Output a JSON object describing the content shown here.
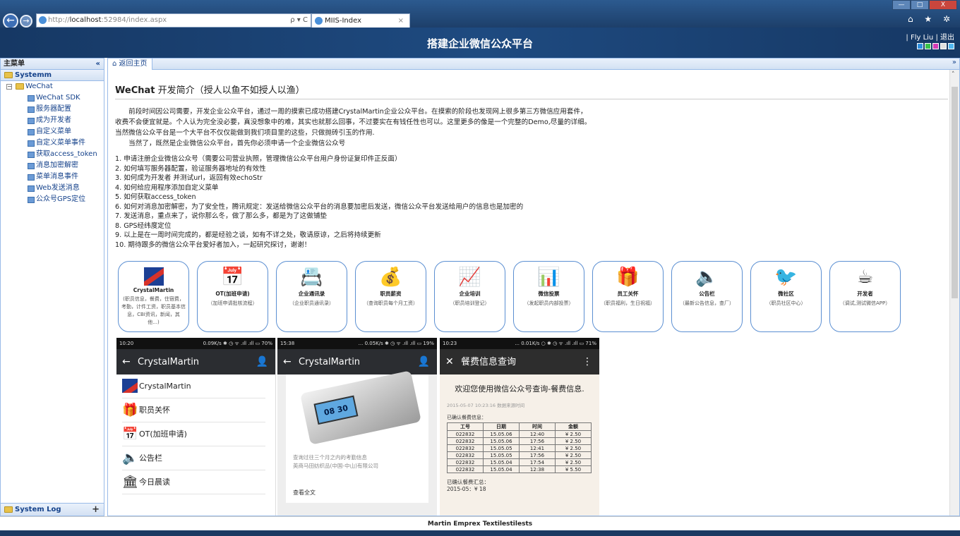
{
  "browser": {
    "url_prefix": "http://",
    "url_host": "localhost",
    "url_rest": ":52984/index.aspx",
    "url_tools": "ρ ▾ C",
    "tab_title": "MIIS-Index",
    "tab_close": "×",
    "icons": "⌂ ★ ✲",
    "win_min": "—",
    "win_max": "□",
    "win_close": "X"
  },
  "header": {
    "title": "搭建企业微信公众平台",
    "user": "| Fly Liu | 退出",
    "swatch_colors": [
      "#2c8fe0",
      "#39c24a",
      "#d63bb5",
      "#e0e0e0",
      "#50b8f2"
    ]
  },
  "sidebar": {
    "title": "主菜单",
    "collapse": "«",
    "system_group": "Systemm",
    "tree_root": "WeChat",
    "items": [
      "WeChat SDK",
      "服务器配置",
      "成为开发者",
      "自定义菜单",
      "自定义菜单事件",
      "获取access_token",
      "消息加密解密",
      "菜单消息事件",
      "Web发送消息",
      "公众号GPS定位"
    ],
    "system_log": "System Log",
    "system_log_plus": "+"
  },
  "main": {
    "home_tab": "⌂ 返回主页",
    "tab_chevron": "»",
    "title_main": "WeChat",
    "title_rest": " 开发简介（授人以鱼不如授人以渔）",
    "intro": [
      "　　前段时间因公司需要，开发企业公众平台，通过一周的摸索已成功搭建CrystalMartin企业公众平台。在摸索的阶段也发现网上很多第三方微信应用套件，",
      "收费不会便宜就是。个人认为完全没必要，真没想象中的难，其实也就那么回事，不过要实在有钱任性也可以。这里更多的像是一个完整的Demo,尽量的详细。",
      "当然微信公众平台是一个大平台不仅仅能做到我们项目里的这些，只做抛砖引玉的作用.",
      "　　当然了，既然是企业微信公众平台，首先你必须申请一个企业微信公众号"
    ],
    "steps": [
      "1. 申请注册企业微信公众号（需要公司营业执照，管理微信公众平台用户身份证复印件正反面）",
      "2. 如何填写服务器配置，验证服务器地址的有效性",
      "3. 如何成为开发者 并测试url，返回有效echoStr",
      "4. 如何给应用程序添加自定义菜单",
      "5. 如何获取access_token",
      "6. 如何对消息加密解密，为了安全性，腾讯规定：发送给微信公众平台的消息要加密后发送，微信公众平台发送给用户的信息也是加密的",
      "7. 发送消息，重点来了，说你那么冬，做了那么多，都是为了这做铺垫",
      "8. GPS经纬度定位",
      "9. 以上是在一周时间完成的，都是经验之谈，如有不详之处，敬请原谅，之后将持续更新",
      "10. 期待跟多的微信公众平台爱好者加入，一起研究探讨，谢谢！"
    ]
  },
  "cards": [
    {
      "icon": "logo",
      "glyph": "",
      "title": "CrystalMartin",
      "sub": "(职员信息，餐费，住宿费，考勤，计件工资，职员基本信息，CBI资讯，新闻，其他...)"
    },
    {
      "icon": "calendar-check-icon",
      "glyph": "📅",
      "title": "OT(加班申请)",
      "sub": "（加班申请批核流程）"
    },
    {
      "icon": "contacts-icon",
      "glyph": "📇",
      "title": "企业通讯录",
      "sub": "（企业职员通讯录）"
    },
    {
      "icon": "money-bag-icon",
      "glyph": "💰",
      "title": "职员薪资",
      "sub": "（查询职员每个月工资）"
    },
    {
      "icon": "presentation-icon",
      "glyph": "📈",
      "title": "企业培训",
      "sub": "（职员培训登记）"
    },
    {
      "icon": "bar-chart-icon",
      "glyph": "📊",
      "title": "微信投票",
      "sub": "（发起职员内部投票）"
    },
    {
      "icon": "gift-icon",
      "glyph": "🎁",
      "title": "员工关怀",
      "sub": "（职员福利，生日祝福）"
    },
    {
      "icon": "speaker-icon",
      "glyph": "🔈",
      "title": "公告栏",
      "sub": "（最新公告信息，查厂）"
    },
    {
      "icon": "bird-icon",
      "glyph": "🐦",
      "title": "微社区",
      "sub": "（职员社区中心）"
    },
    {
      "icon": "coffee-java-icon",
      "glyph": "☕",
      "title": "开发者",
      "sub": "（调试,测试微信APP）"
    }
  ],
  "phone1": {
    "time": "10:20",
    "status": "0.09K/s ✱ ◷ ᯤ .ıll .ıll ▭ 70%",
    "back": "←",
    "title": "CrystalMartin",
    "user": "👤",
    "items": [
      {
        "icon": "logo",
        "glyph": "",
        "label": "CrystalMartin"
      },
      {
        "icon": "gift-icon",
        "glyph": "🎁",
        "label": "职员关怀"
      },
      {
        "icon": "calendar-check-icon",
        "glyph": "📅",
        "label": "OT(加班申请)"
      },
      {
        "icon": "speaker-icon",
        "glyph": "🔈",
        "label": "公告栏"
      },
      {
        "icon": "building-icon",
        "glyph": "🏛",
        "label": "今日晨读"
      }
    ]
  },
  "phone2": {
    "time": "15:38",
    "status": "... 0.05K/s ✱ ◷ ᯤ .ıll .ıll ▭ 19%",
    "back": "←",
    "title": "CrystalMartin",
    "user": "👤",
    "device_screen": "08 30",
    "text1": "查询过往三个月之内的考勤信息",
    "text2": "英商马田纺织品(中国-中山)有限公司",
    "read_all": "查看全文"
  },
  "phone3": {
    "time": "10:23",
    "status": "... 0.01K/s ○ ✱ ◷ ᯤ .ıll .ıll ▭ 71%",
    "close": "✕",
    "title": "餐费信息查询",
    "menu": "⋮",
    "welcome": "欢迎您使用微信公众号查询-餐费信息.",
    "meta": "2015-05-07 10:23:16 数据来源时间",
    "confirmed": "已确认餐费信息：",
    "table_headers": [
      "工号",
      "日期",
      "时间",
      "金额"
    ],
    "table_rows": [
      [
        "022832",
        "15.05.06",
        "12:40",
        "¥ 2.50"
      ],
      [
        "022832",
        "15.05.06",
        "17:56",
        "¥ 2.50"
      ],
      [
        "022832",
        "15.05.05",
        "12:41",
        "¥ 2.50"
      ],
      [
        "022832",
        "15.05.05",
        "17:56",
        "¥ 2.50"
      ],
      [
        "022832",
        "15.05.04",
        "17:54",
        "¥ 2.50"
      ],
      [
        "022832",
        "15.05.04",
        "12:38",
        "¥ 5.50"
      ]
    ],
    "summary_title": "已确认餐费汇总：",
    "summary": "2015-05：¥ 18"
  },
  "footer": "Martin Emprex Textilestilests"
}
